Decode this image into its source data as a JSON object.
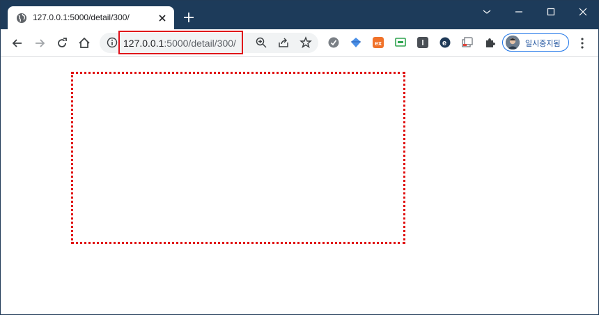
{
  "tab": {
    "title": "127.0.0.1:5000/detail/300/"
  },
  "omnibox": {
    "host": "127.0.0.1",
    "path": ":5000/detail/300/"
  },
  "profile": {
    "name": "일시중지됨"
  },
  "icons": {
    "tab_favicon": "globe-icon",
    "tab_close": "close-icon",
    "new_tab": "plus-icon",
    "window_list": "chevron-down-icon",
    "minimize": "minimize-icon",
    "maximize": "maximize-icon",
    "close_window": "close-icon",
    "back": "back-arrow-icon",
    "forward": "forward-arrow-icon",
    "reload": "reload-icon",
    "home": "home-icon",
    "site_info": "info-icon",
    "zoom": "zoom-in-icon",
    "share": "share-icon",
    "bookmark": "star-icon",
    "extensions": "puzzle-icon",
    "menu": "kebab-menu-icon"
  },
  "colors": {
    "titlebar": "#1d3b5a",
    "highlight_border": "#e0101a",
    "dotted_frame": "#e01010",
    "profile_accent": "#1a73e8"
  }
}
